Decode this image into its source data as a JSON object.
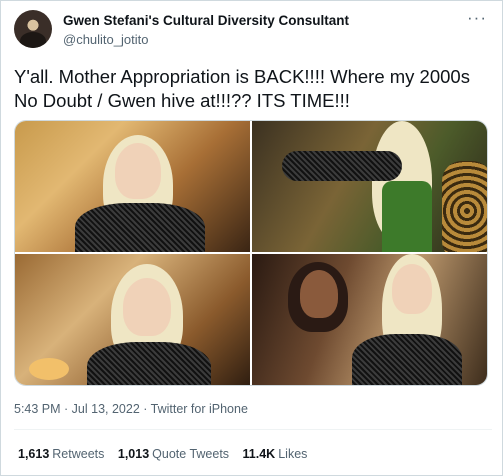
{
  "user": {
    "display_name": "Gwen Stefani's Cultural Diversity Consultant",
    "handle": "@chulito_jotito"
  },
  "more_icon": "more-horizontal-icon",
  "tweet": {
    "text": "Y'all. Mother Appropriation is BACK!!!! Where my 2000s No Doubt / Gwen hive at!!!?? ITS TIME!!!",
    "timestamp": "5:43 PM · Jul 13, 2022 · Twitter for iPhone"
  },
  "stats": {
    "retweets_count": "1,613",
    "retweets_label": "Retweets",
    "quotes_count": "1,013",
    "quotes_label": "Quote Tweets",
    "likes_count": "11.4K",
    "likes_label": "Likes"
  },
  "colors": {
    "text_primary": "#0f1419",
    "text_secondary": "#536471",
    "border": "#cfd9de"
  }
}
